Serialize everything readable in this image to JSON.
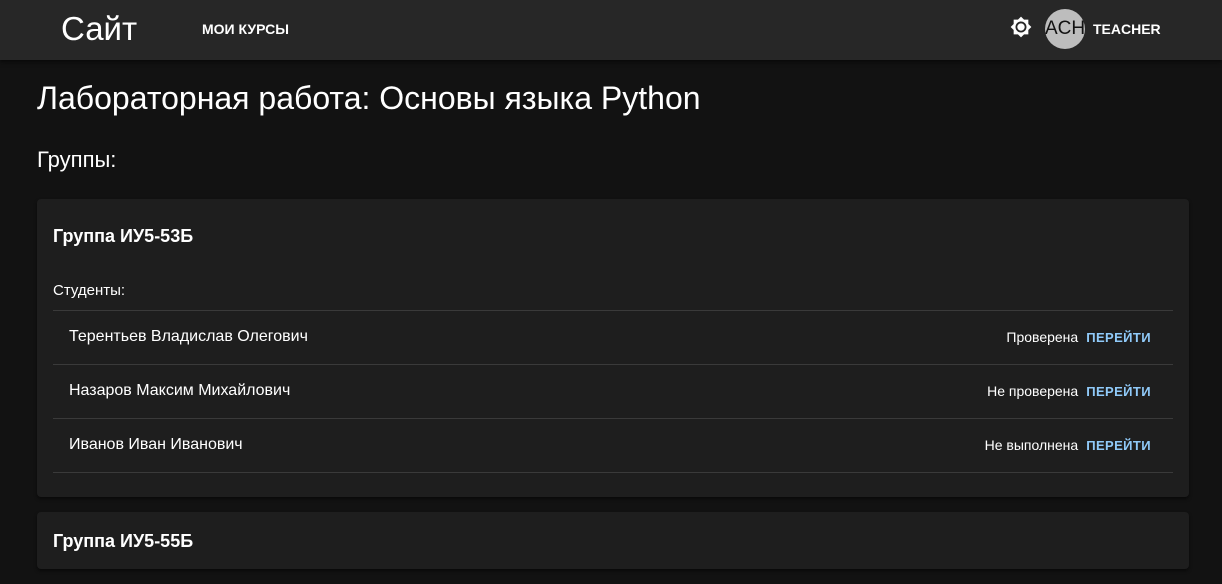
{
  "appbar": {
    "site_title": "Сайт",
    "nav_courses": "МОИ КУРСЫ",
    "theme_icon": "brightness-icon",
    "avatar_initials": "ACH",
    "user_name": "TEACHER"
  },
  "page": {
    "title": "Лабораторная работа: Основы языка Python",
    "groups_heading": "Группы:"
  },
  "groups": [
    {
      "title": "Группа ИУ5-53Б",
      "students_label": "Студенты:",
      "students": [
        {
          "name": "Терентьев Владислав Олегович",
          "status": "Проверена",
          "action": "ПЕРЕЙТИ"
        },
        {
          "name": "Назаров Максим Михайлович",
          "status": "Не проверена",
          "action": "ПЕРЕЙТИ"
        },
        {
          "name": "Иванов Иван Иванович",
          "status": "Не выполнена",
          "action": "ПЕРЕЙТИ"
        }
      ]
    },
    {
      "title": "Группа ИУ5-55Б"
    }
  ],
  "colors": {
    "background": "#121212",
    "appbar": "#272727",
    "card": "#1e1e1e",
    "link": "#90caf9"
  }
}
